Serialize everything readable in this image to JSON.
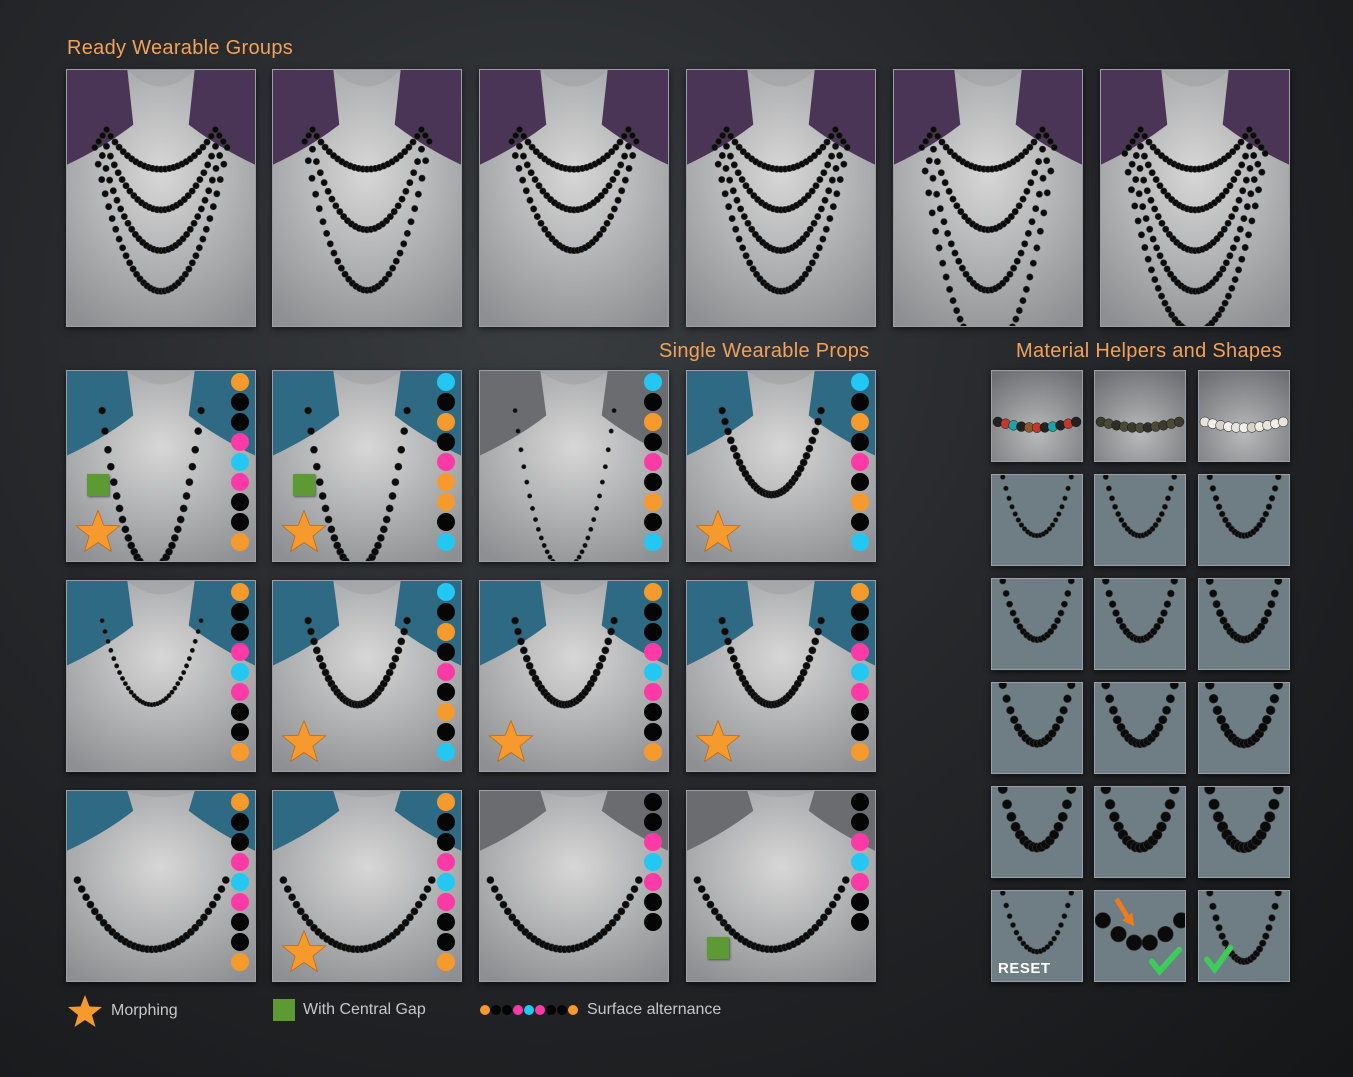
{
  "titles": {
    "ready_groups": "Ready Wearable Groups",
    "single_props": "Single Wearable Props",
    "material_helpers": "Material Helpers and Shapes"
  },
  "colors": {
    "title": "#f2a25a",
    "orange": "#f79a2e",
    "pink": "#ff3aa6",
    "cyan": "#22c8f2",
    "black": "#050505",
    "green": "#5e9a34",
    "check": "#3ccc5a",
    "purple_bg": "#4a3556",
    "teal_bg": "#2f6a84",
    "slate_bg": "#6e7e84"
  },
  "ready_groups": [
    {
      "strands": 4,
      "style": "multi-short"
    },
    {
      "strands": 3,
      "style": "multi-long"
    },
    {
      "strands": 3,
      "style": "multi-choker"
    },
    {
      "strands": 4,
      "style": "multi-medium"
    },
    {
      "strands": 4,
      "style": "multi-long-heavy"
    },
    {
      "strands": 5,
      "style": "multi-layered"
    }
  ],
  "single_props": [
    {
      "dots": [
        "orange",
        "black",
        "black",
        "pink",
        "cyan",
        "pink",
        "black",
        "black",
        "orange"
      ],
      "morphing": true,
      "gap": true,
      "bg": "teal",
      "length": "long"
    },
    {
      "dots": [
        "cyan",
        "black",
        "orange",
        "black",
        "pink",
        "orange",
        "orange",
        "black",
        "cyan"
      ],
      "morphing": true,
      "gap": true,
      "bg": "teal",
      "length": "long"
    },
    {
      "dots": [
        "cyan",
        "black",
        "orange",
        "black",
        "pink",
        "black",
        "orange",
        "black",
        "cyan"
      ],
      "morphing": false,
      "gap": false,
      "bg": "none",
      "length": "long-thin"
    },
    {
      "dots": [
        "cyan",
        "black",
        "orange",
        "black",
        "pink",
        "black",
        "orange",
        "black",
        "cyan"
      ],
      "morphing": true,
      "gap": false,
      "bg": "teal",
      "length": "medium"
    },
    {
      "dots": [
        "orange",
        "black",
        "black",
        "pink",
        "cyan",
        "pink",
        "black",
        "black",
        "orange"
      ],
      "morphing": false,
      "gap": false,
      "bg": "teal",
      "length": "medium-thin"
    },
    {
      "dots": [
        "cyan",
        "black",
        "orange",
        "black",
        "pink",
        "black",
        "orange",
        "black",
        "cyan"
      ],
      "morphing": true,
      "gap": false,
      "bg": "teal",
      "length": "medium"
    },
    {
      "dots": [
        "orange",
        "black",
        "black",
        "pink",
        "cyan",
        "pink",
        "black",
        "black",
        "orange"
      ],
      "morphing": true,
      "gap": false,
      "bg": "teal",
      "length": "medium"
    },
    {
      "dots": [
        "orange",
        "black",
        "black",
        "pink",
        "cyan",
        "pink",
        "black",
        "black",
        "orange"
      ],
      "morphing": true,
      "gap": false,
      "bg": "teal",
      "length": "medium"
    },
    {
      "dots": [
        "orange",
        "black",
        "black",
        "pink",
        "cyan",
        "pink",
        "black",
        "black",
        "orange"
      ],
      "morphing": false,
      "gap": false,
      "bg": "teal",
      "length": "short"
    },
    {
      "dots": [
        "orange",
        "black",
        "black",
        "pink",
        "cyan",
        "pink",
        "black",
        "black",
        "orange"
      ],
      "morphing": true,
      "gap": false,
      "bg": "teal",
      "length": "short"
    },
    {
      "dots": [
        "black",
        "black",
        "pink",
        "cyan",
        "pink",
        "black",
        "black"
      ],
      "morphing": false,
      "gap": false,
      "bg": "none",
      "length": "short"
    },
    {
      "dots": [
        "black",
        "black",
        "pink",
        "cyan",
        "pink",
        "black",
        "black"
      ],
      "morphing": false,
      "gap": true,
      "bg": "none",
      "length": "short-gap"
    }
  ],
  "material_top": [
    {
      "beads": "multicolor"
    },
    {
      "beads": "pearl-dark"
    },
    {
      "beads": "pearl-white"
    }
  ],
  "shape_rows": 5,
  "helper_row": [
    {
      "label": "RESET",
      "kind": "reset"
    },
    {
      "label": "",
      "kind": "arrow-check"
    },
    {
      "label": "",
      "kind": "check"
    }
  ],
  "legend": {
    "morphing": "Morphing",
    "gap": "With Central Gap",
    "alternance": "Surface alternance",
    "alternance_dots": [
      "orange",
      "black",
      "black",
      "pink",
      "cyan",
      "pink",
      "black",
      "black",
      "orange"
    ]
  }
}
